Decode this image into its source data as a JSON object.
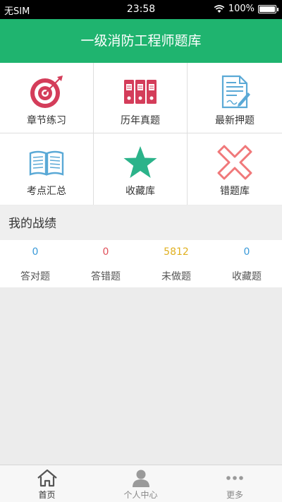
{
  "status_bar": {
    "carrier": "无SIM",
    "time": "23:58",
    "battery": "100%"
  },
  "header": {
    "title": "一级消防工程师题库"
  },
  "menu": [
    {
      "label": "章节练习",
      "icon": "target-icon"
    },
    {
      "label": "历年真题",
      "icon": "binders-icon"
    },
    {
      "label": "最新押题",
      "icon": "document-edit-icon"
    },
    {
      "label": "考点汇总",
      "icon": "open-book-icon"
    },
    {
      "label": "收藏库",
      "icon": "star-icon"
    },
    {
      "label": "错题库",
      "icon": "cross-icon"
    }
  ],
  "stats_section": {
    "title": "我的战绩"
  },
  "stats": [
    {
      "value": "0",
      "label": "答对题",
      "color": "#3a9ad9"
    },
    {
      "value": "0",
      "label": "答错题",
      "color": "#e0505a"
    },
    {
      "value": "5812",
      "label": "未做题",
      "color": "#e0b020"
    },
    {
      "value": "0",
      "label": "收藏题",
      "color": "#3a9ad9"
    }
  ],
  "tabs": [
    {
      "label": "首页",
      "icon": "home-icon",
      "active": true
    },
    {
      "label": "个人中心",
      "icon": "person-icon",
      "active": false
    },
    {
      "label": "更多",
      "icon": "more-dots-icon",
      "active": false
    }
  ],
  "colors": {
    "brand_green": "#1fb46f",
    "icon_red": "#d43d5a",
    "icon_blue": "#5aa9d6",
    "icon_green": "#2bb38a",
    "icon_pink": "#f0787a"
  }
}
